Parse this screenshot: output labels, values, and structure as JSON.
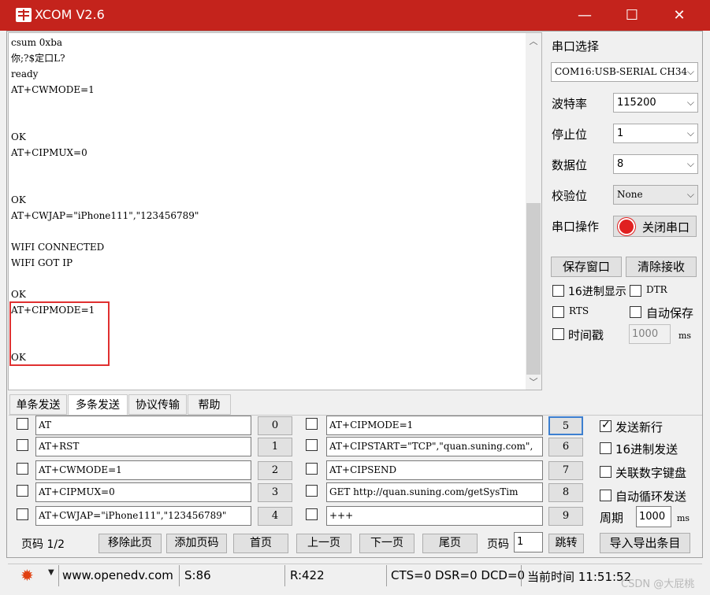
{
  "window": {
    "title": "XCOM V2.6",
    "title_bar_color": "#c4231c",
    "minimize": "—",
    "maximize": "☐",
    "close": "✕"
  },
  "receive_lines": [
    "csum 0xba",
    "你;?$定口L?",
    "ready",
    "AT+CWMODE=1",
    "",
    "",
    "OK",
    "AT+CIPMUX=0",
    "",
    "",
    "OK",
    "AT+CWJAP=\"iPhone111\",\"123456789\"",
    "",
    "WIFI CONNECTED",
    "WIFI GOT IP",
    "",
    "OK",
    "AT+CIPMODE=1",
    "",
    "",
    "OK"
  ],
  "serial": {
    "port_label": "串口选择",
    "port_value": "COM16:USB-SERIAL CH34",
    "baud_label": "波特率",
    "baud_value": "115200",
    "stop_label": "停止位",
    "stop_value": "1",
    "data_label": "数据位",
    "data_value": "8",
    "parity_label": "校验位",
    "parity_value": "None",
    "op_label": "串口操作",
    "op_button": "关闭串口",
    "save_window": "保存窗口",
    "clear_receive": "清除接收",
    "hex_display": "16进制显示",
    "dtr": "DTR",
    "rts": "RTS",
    "auto_save": "自动保存",
    "timestamp": "时间戳",
    "timestamp_value": "1000",
    "timestamp_unit": "ms"
  },
  "tabs": [
    "单条发送",
    "多条发送",
    "协议传输",
    "帮助"
  ],
  "multi_send": {
    "left": [
      {
        "text": "AT",
        "num": "0"
      },
      {
        "text": "AT+RST",
        "num": "1"
      },
      {
        "text": "AT+CWMODE=1",
        "num": "2"
      },
      {
        "text": "AT+CIPMUX=0",
        "num": "3"
      },
      {
        "text": "AT+CWJAP=\"iPhone111\",\"123456789\"",
        "num": "4"
      }
    ],
    "right": [
      {
        "text": "AT+CIPMODE=1",
        "num": "5"
      },
      {
        "text": "AT+CIPSTART=\"TCP\",\"quan.suning.com\",",
        "num": "6"
      },
      {
        "text": "AT+CIPSEND",
        "num": "7"
      },
      {
        "text": "GET http://quan.suning.com/getSysTim",
        "num": "8"
      },
      {
        "text": "+++",
        "num": "9"
      }
    ],
    "options": {
      "send_newline": "发送新行",
      "hex_send": "16进制发送",
      "link_keypad": "关联数字键盘",
      "auto_loop": "自动循环发送"
    },
    "period_label": "周期",
    "period_value": "1000",
    "period_unit": "ms",
    "page_label": "页码 1/2",
    "remove_page": "移除此页",
    "add_page": "添加页码",
    "first_page": "首页",
    "prev_page": "上一页",
    "next_page": "下一页",
    "last_page": "尾页",
    "goto_label": "页码",
    "goto_value": "1",
    "goto_button": "跳转",
    "import_export": "导入导出条目"
  },
  "status": {
    "website": "www.openedv.com",
    "sent": "S:86",
    "received": "R:422",
    "signals": "CTS=0 DSR=0 DCD=0",
    "time": "当前时间 11:51:52"
  },
  "watermark": "CSDN @大屁桃"
}
